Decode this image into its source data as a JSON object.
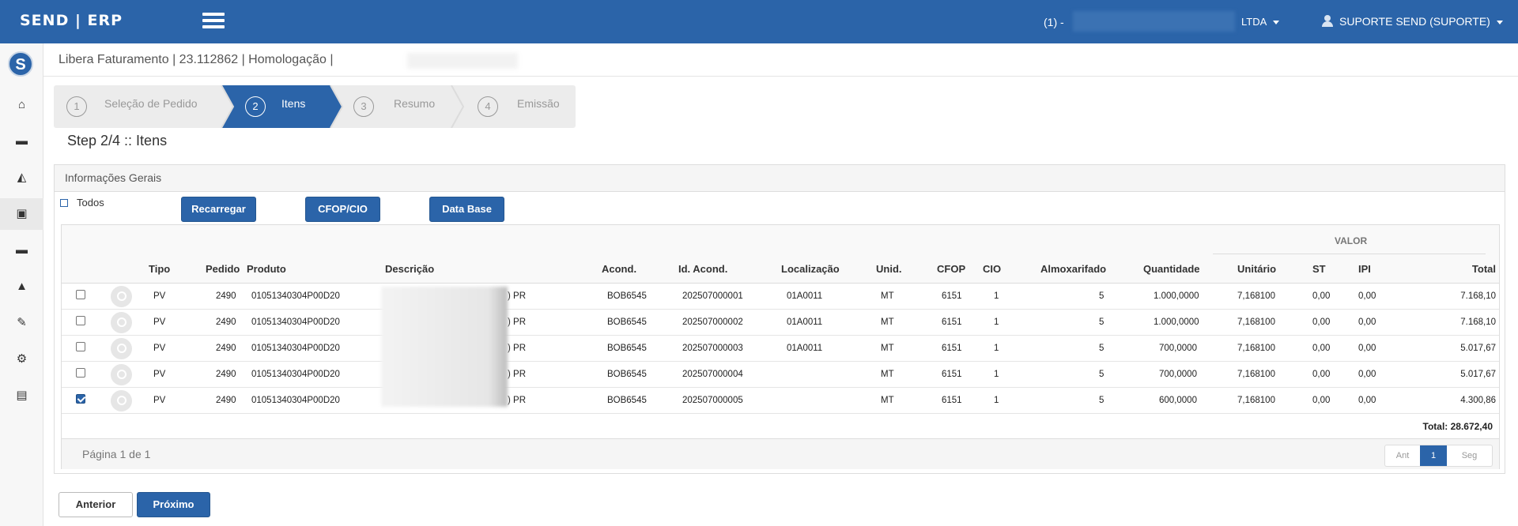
{
  "header": {
    "brand": "SEND | ERP",
    "company_prefix": "(1) -",
    "company_suffix": "LTDA",
    "user": "SUPORTE SEND (SUPORTE)"
  },
  "sidebar": {
    "logo_letter": "S",
    "items": [
      {
        "icon": "home-icon",
        "glyph": "⌂"
      },
      {
        "icon": "truck-icon",
        "glyph": "▬"
      },
      {
        "icon": "chart-icon",
        "glyph": "◭"
      },
      {
        "icon": "id-card-icon",
        "glyph": "▣"
      },
      {
        "icon": "truck-icon",
        "glyph": "▬"
      },
      {
        "icon": "road-icon",
        "glyph": "▲"
      },
      {
        "icon": "wrench-icon",
        "glyph": "✎"
      },
      {
        "icon": "gears-icon",
        "glyph": "⚙"
      },
      {
        "icon": "print-icon",
        "glyph": "▤"
      }
    ]
  },
  "breadcrumb": "Libera Faturamento | 23.112862 | Homologação |",
  "wizard": {
    "steps": [
      {
        "num": "1",
        "label": "Seleção de Pedido"
      },
      {
        "num": "2",
        "label": "Itens"
      },
      {
        "num": "3",
        "label": "Resumo"
      },
      {
        "num": "4",
        "label": "Emissão"
      }
    ]
  },
  "step_title": "Step 2/4 :: Itens",
  "panel": {
    "title": "Informações Gerais",
    "todos_label": "Todos",
    "buttons": {
      "recarregar": "Recarregar",
      "cfop": "CFOP/CIO",
      "database": "Data Base"
    }
  },
  "table": {
    "group_header": "VALOR",
    "headers": {
      "tipo": "Tipo",
      "pedido": "Pedido",
      "produto": "Produto",
      "descricao": "Descrição",
      "acond": "Acond.",
      "id_acond": "Id. Acond.",
      "localizacao": "Localização",
      "unid": "Unid.",
      "cfop": "CFOP",
      "cio": "CIO",
      "almox": "Almoxarifado",
      "quantidade": "Quantidade",
      "unitario": "Unitário",
      "st": "ST",
      "ipi": "IPI",
      "total": "Total"
    },
    "rows": [
      {
        "checked": false,
        "tipo": "PV",
        "pedido": "2490",
        "produto": "01051340304P00D20",
        "descricao": ") PR",
        "acond": "BOB6545",
        "id_acond": "202507000001",
        "localizacao": "01A0011",
        "unid": "MT",
        "cfop": "6151",
        "cio": "1",
        "almox": "5",
        "quantidade": "1.000,0000",
        "unitario": "7,168100",
        "st": "0,00",
        "ipi": "0,00",
        "total": "7.168,10"
      },
      {
        "checked": false,
        "tipo": "PV",
        "pedido": "2490",
        "produto": "01051340304P00D20",
        "descricao": ") PR",
        "acond": "BOB6545",
        "id_acond": "202507000002",
        "localizacao": "01A0011",
        "unid": "MT",
        "cfop": "6151",
        "cio": "1",
        "almox": "5",
        "quantidade": "1.000,0000",
        "unitario": "7,168100",
        "st": "0,00",
        "ipi": "0,00",
        "total": "7.168,10"
      },
      {
        "checked": false,
        "tipo": "PV",
        "pedido": "2490",
        "produto": "01051340304P00D20",
        "descricao": ") PR",
        "acond": "BOB6545",
        "id_acond": "202507000003",
        "localizacao": "01A0011",
        "unid": "MT",
        "cfop": "6151",
        "cio": "1",
        "almox": "5",
        "quantidade": "700,0000",
        "unitario": "7,168100",
        "st": "0,00",
        "ipi": "0,00",
        "total": "5.017,67"
      },
      {
        "checked": false,
        "tipo": "PV",
        "pedido": "2490",
        "produto": "01051340304P00D20",
        "descricao": ") PR",
        "acond": "BOB6545",
        "id_acond": "202507000004",
        "localizacao": "",
        "unid": "MT",
        "cfop": "6151",
        "cio": "1",
        "almox": "5",
        "quantidade": "700,0000",
        "unitario": "7,168100",
        "st": "0,00",
        "ipi": "0,00",
        "total": "5.017,67"
      },
      {
        "checked": true,
        "tipo": "PV",
        "pedido": "2490",
        "produto": "01051340304P00D20",
        "descricao": ") PR",
        "acond": "BOB6545",
        "id_acond": "202507000005",
        "localizacao": "",
        "unid": "MT",
        "cfop": "6151",
        "cio": "1",
        "almox": "5",
        "quantidade": "600,0000",
        "unitario": "7,168100",
        "st": "0,00",
        "ipi": "0,00",
        "total": "4.300,86"
      }
    ],
    "total_label": "Total: 28.672,40",
    "page_info": "Página 1 de 1",
    "pager": {
      "prev": "Ant",
      "current": "1",
      "next": "Seg"
    }
  },
  "footer_buttons": {
    "anterior": "Anterior",
    "proximo": "Próximo"
  },
  "colors": {
    "primary": "#2b64a9",
    "wizard_bg": "#ececec"
  }
}
